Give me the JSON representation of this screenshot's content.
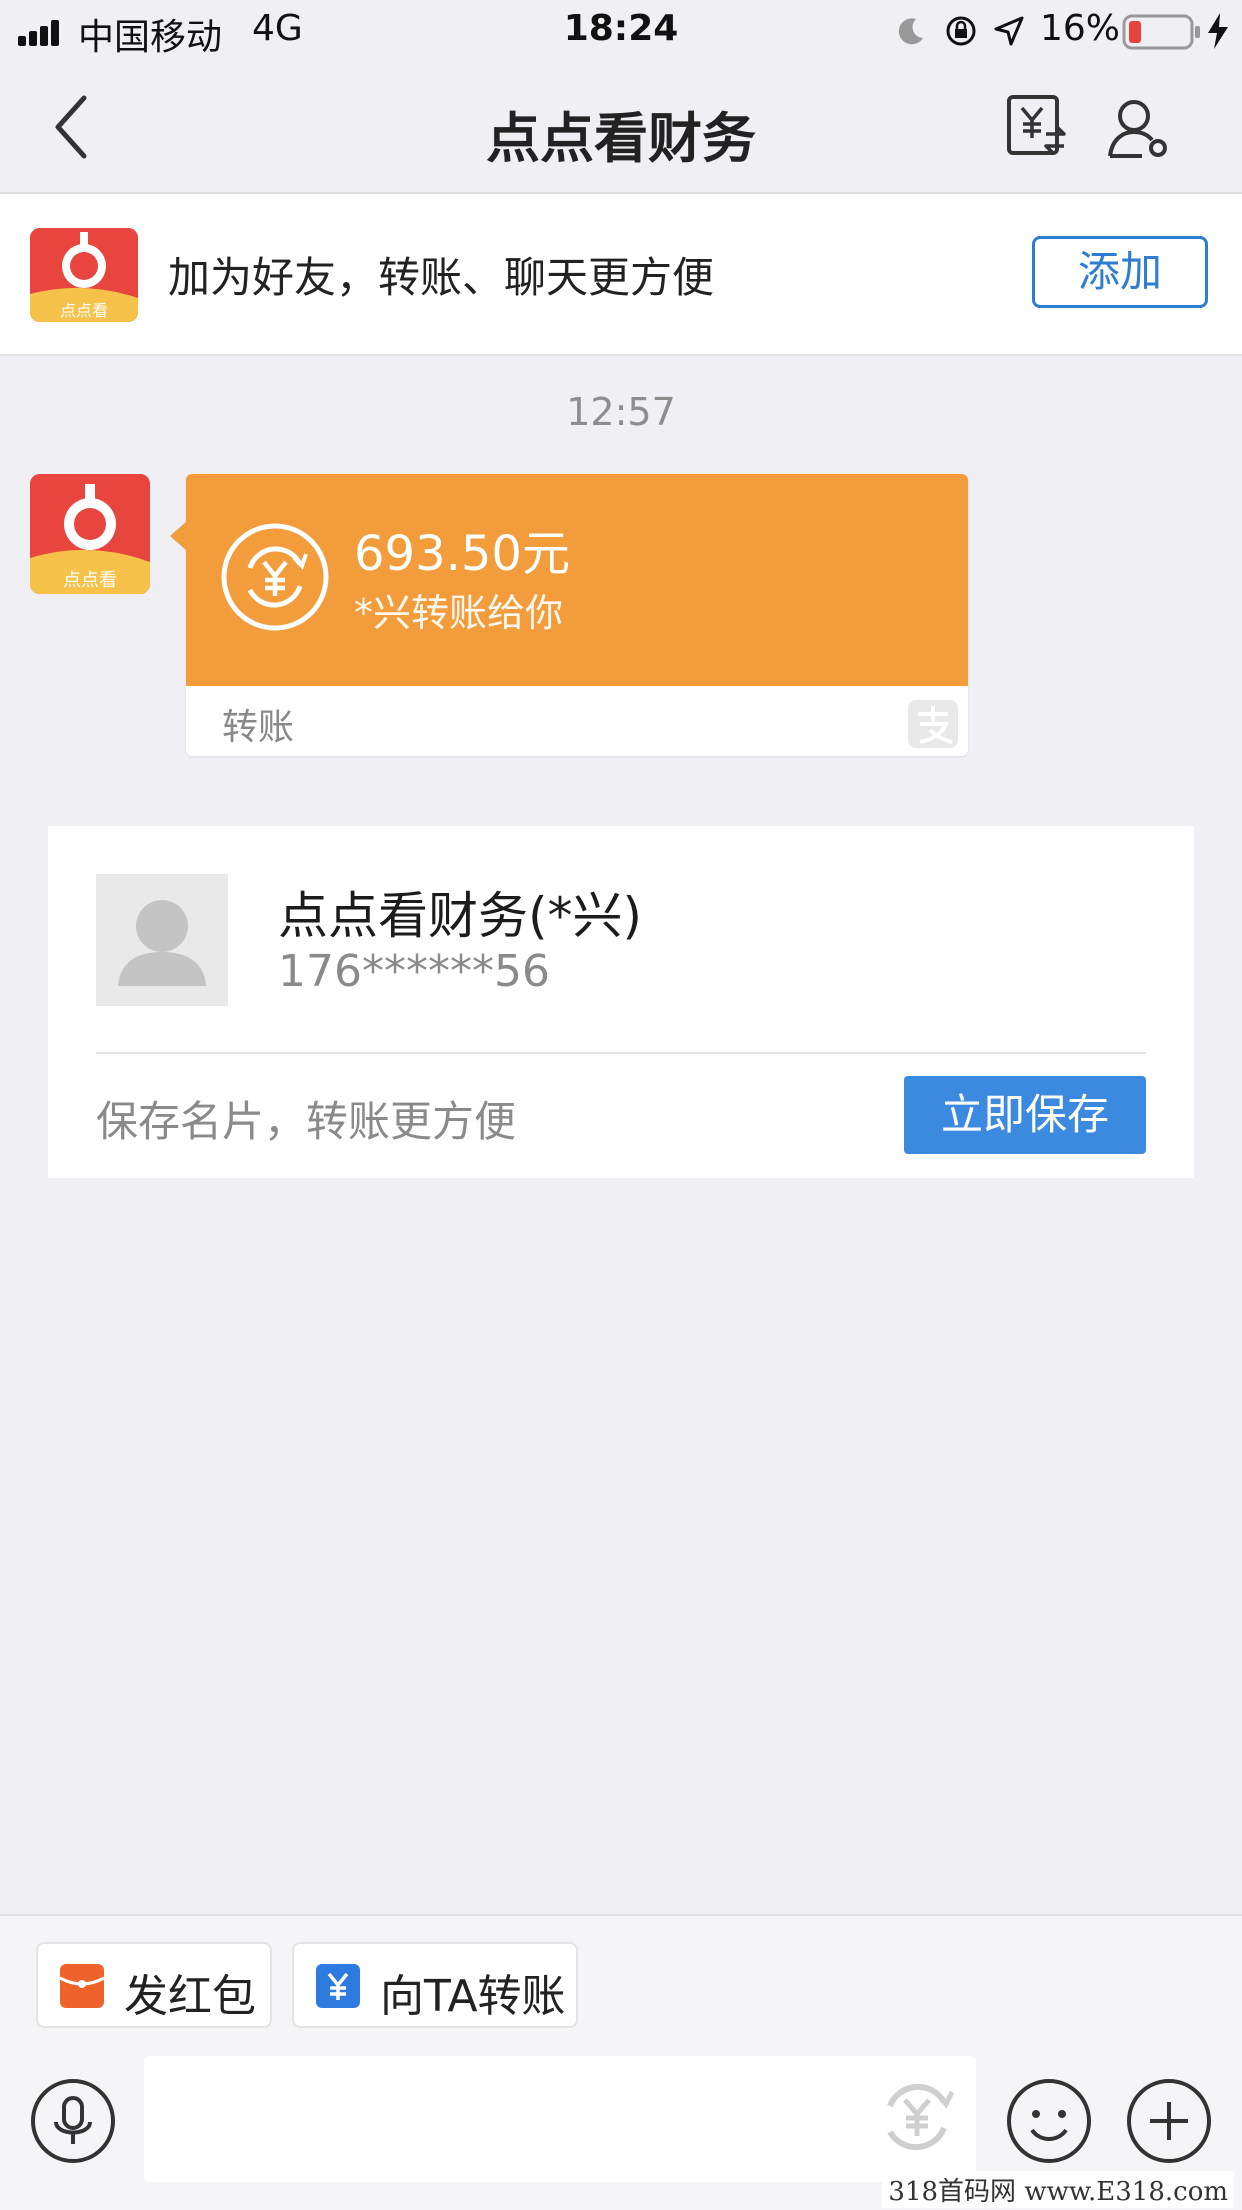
{
  "status_bar": {
    "carrier": "中国移动",
    "network": "4G",
    "time": "18:24",
    "battery": "16%"
  },
  "nav": {
    "title": "点点看财务",
    "icons": [
      "back-icon",
      "transfer-records-icon",
      "profile-settings-icon"
    ]
  },
  "banner": {
    "logo_text": "点点看",
    "text": "加为好友，转账、聊天更方便",
    "add_label": "添加"
  },
  "chat": {
    "timestamp": "12:57",
    "avatar_text": "点点看",
    "transfer": {
      "amount": "693.50元",
      "note": "*兴转账给你",
      "label": "转账"
    }
  },
  "card": {
    "name": "点点看财务(*兴)",
    "phone": "176******56",
    "hint": "保存名片，转账更方便",
    "save_label": "立即保存"
  },
  "tools": {
    "red_packet_label": "发红包",
    "transfer_label": "向TA转账"
  },
  "watermark": "318首码网 www.E318.com",
  "colors": {
    "accent_blue": "#2d7ed3",
    "transfer_orange": "#f29c3b",
    "save_button": "#3c8ae0"
  }
}
